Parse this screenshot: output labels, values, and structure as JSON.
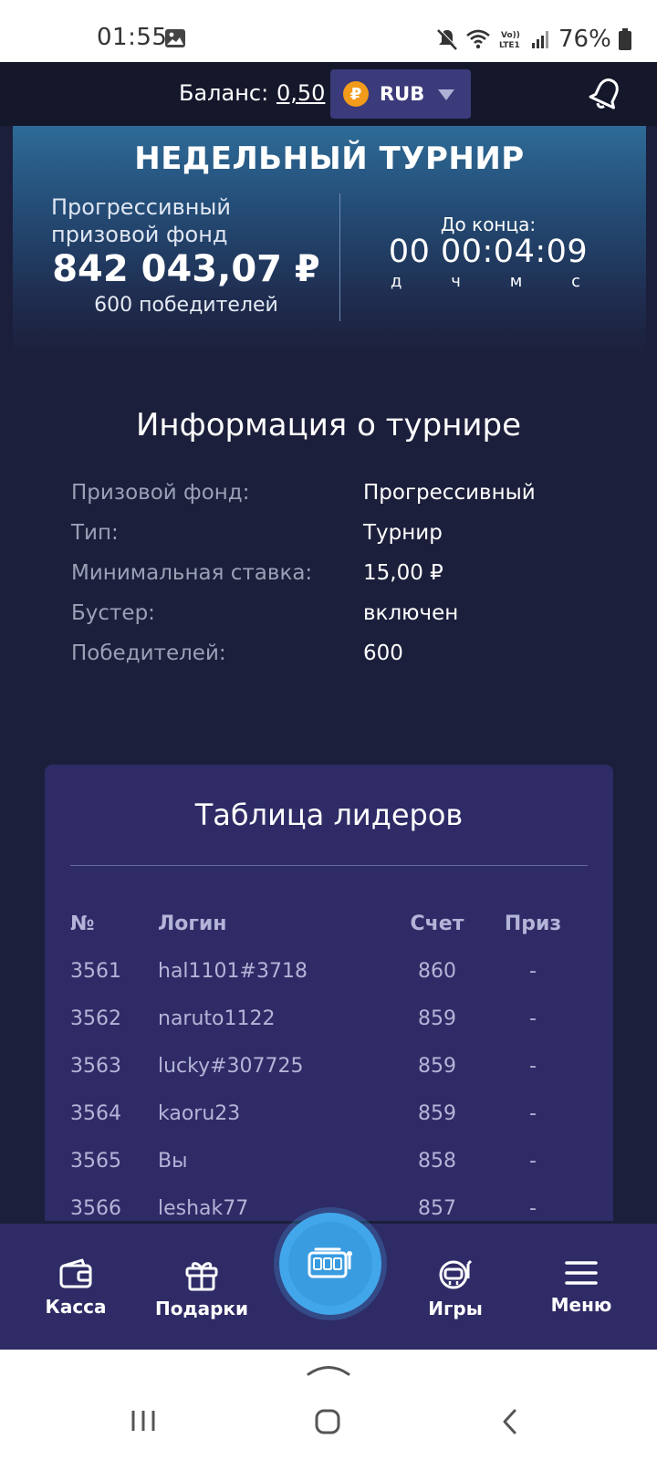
{
  "status_bar": {
    "time": "01:55",
    "battery": "76%",
    "icons": [
      "image-icon",
      "mute-icon",
      "wifi-icon",
      "volte-icon",
      "signal-icon",
      "battery-icon"
    ]
  },
  "header": {
    "balance_label": "Баланс:",
    "balance_value": "0,50",
    "currency": "RUB",
    "currency_symbol": "₽"
  },
  "banner": {
    "title": "НЕДЕЛЬНЫЙ ТУРНИР",
    "prize_type_label": "Прогрессивный призовой фонд",
    "prize_amount": "842 043,07 ₽",
    "winners": "600 победителей",
    "until_end_label": "До конца:",
    "countdown": "00 00:04:09",
    "units": [
      "д",
      "ч",
      "м",
      "с"
    ]
  },
  "info": {
    "title": "Информация о турнире",
    "rows": [
      {
        "label": "Призовой фонд:",
        "value": "Прогрессивный"
      },
      {
        "label": "Тип:",
        "value": "Турнир"
      },
      {
        "label": "Минимальная ставка:",
        "value": "15,00 ₽"
      },
      {
        "label": "Бустер:",
        "value": "включен"
      },
      {
        "label": "Победителей:",
        "value": "600"
      }
    ]
  },
  "leaderboard": {
    "title": "Таблица лидеров",
    "headers": [
      "№",
      "Логин",
      "Счет",
      "Приз"
    ],
    "rows": [
      {
        "rank": "3561",
        "login": "hal1101#3718",
        "score": "860",
        "prize": "-"
      },
      {
        "rank": "3562",
        "login": "naruto1122",
        "score": "859",
        "prize": "-"
      },
      {
        "rank": "3563",
        "login": "lucky#307725",
        "score": "859",
        "prize": "-"
      },
      {
        "rank": "3564",
        "login": "kaoru23",
        "score": "859",
        "prize": "-"
      },
      {
        "rank": "3565",
        "login": "Вы",
        "score": "858",
        "prize": "-"
      },
      {
        "rank": "3566",
        "login": "leshak77",
        "score": "857",
        "prize": "-"
      }
    ]
  },
  "bottom_nav": {
    "items": [
      {
        "label": "Касса",
        "icon": "wallet-icon"
      },
      {
        "label": "Подарки",
        "icon": "gift-icon"
      },
      {
        "label": "",
        "icon": "slot-machine-icon"
      },
      {
        "label": "Игры",
        "icon": "games-icon"
      },
      {
        "label": "Меню",
        "icon": "menu-icon"
      }
    ]
  },
  "colors": {
    "background": "#1c1f3b",
    "header": "#15182b",
    "card": "#2e2b66",
    "accent_blue": "#42a6ea",
    "coin": "#f39b1a"
  }
}
